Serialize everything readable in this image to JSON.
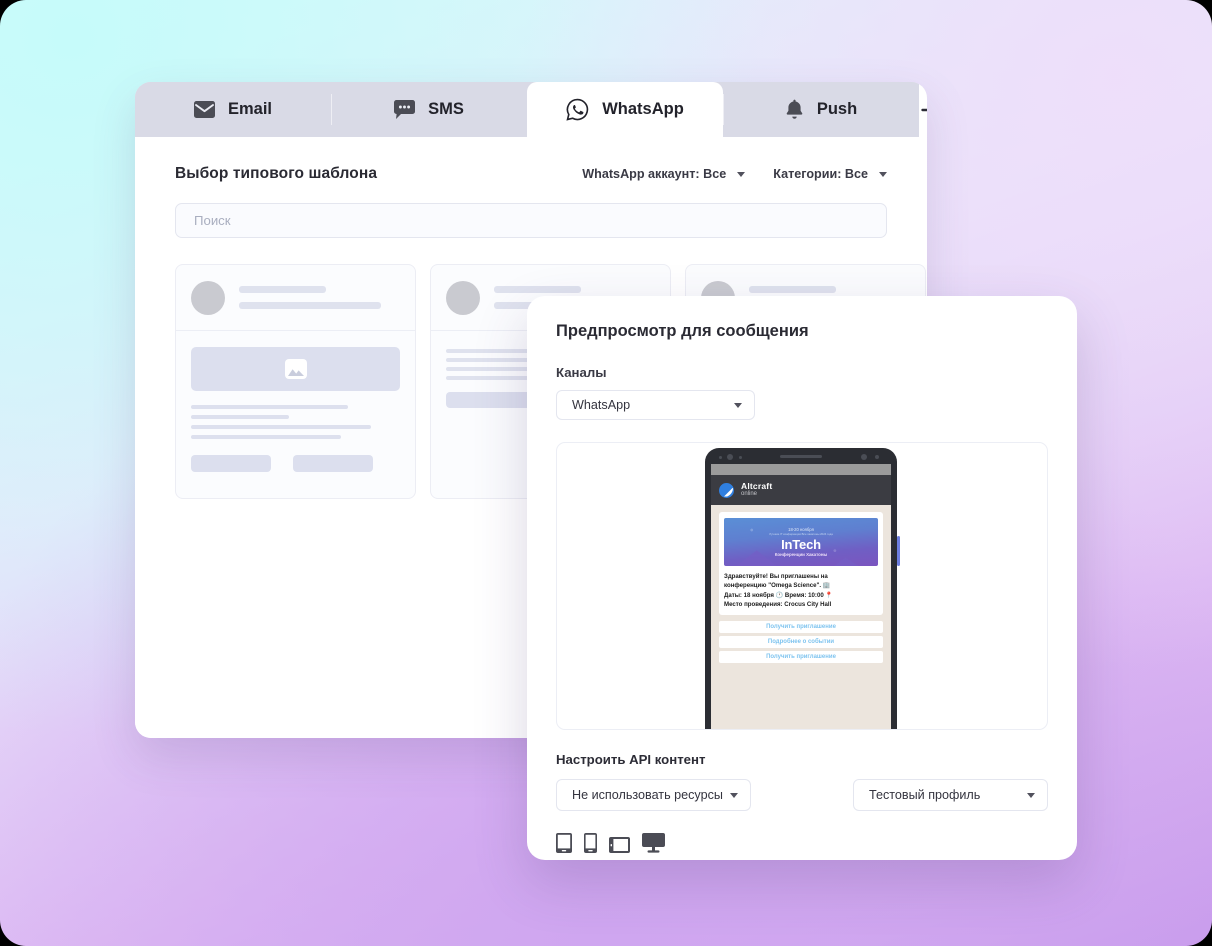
{
  "tabs": [
    {
      "id": "email",
      "label": "Email",
      "icon": "envelope-icon",
      "active": false
    },
    {
      "id": "sms",
      "label": "SMS",
      "icon": "speech-bubble-icon",
      "active": false
    },
    {
      "id": "whatsapp",
      "label": "WhatsApp",
      "icon": "whatsapp-icon",
      "active": true
    },
    {
      "id": "push",
      "label": "Push",
      "icon": "bell-icon",
      "active": false
    }
  ],
  "add_tab": {
    "label": "+",
    "icon": "plus-icon"
  },
  "panel": {
    "title": "Выбор типового шаблона",
    "filters": [
      {
        "id": "whatsapp-account",
        "label": "WhatsApp аккаунт: Все"
      },
      {
        "id": "categories",
        "label": "Категории: Все"
      }
    ],
    "search": {
      "placeholder": "Поиск",
      "value": ""
    }
  },
  "modal": {
    "title": "Предпросмотр для сообщения",
    "channels_label": "Каналы",
    "channel_value": "WhatsApp",
    "api_label": "Настроить API контент",
    "resource_value": "Не использовать ресурсы",
    "profile_value": "Тестовый профиль",
    "devices": [
      {
        "id": "tablet-portrait",
        "icon": "tablet-portrait-icon"
      },
      {
        "id": "phone-portrait",
        "icon": "phone-portrait-icon"
      },
      {
        "id": "tablet-landscape",
        "icon": "tablet-landscape-icon"
      },
      {
        "id": "desktop",
        "icon": "desktop-icon"
      }
    ]
  },
  "phone_preview": {
    "chat_title": "Altcraft",
    "chat_status": "online",
    "banner": {
      "date": "18-20 ноября",
      "subtitle_top": "Лучшие IT конференции\nВсе хакатоны 2024 года",
      "title": "InTech",
      "subtitle": "Конференции\nХакатоны"
    },
    "message_lines": [
      "Здравствуйте! Вы приглашены на",
      "конференцию \"Omega Science\". 🏢",
      "Даты: 18 ноября 🕐 Время: 10:00 📍",
      "Место проведения: Crocus City Hall"
    ],
    "buttons": [
      "Получить приглашение",
      "Подробнее о событии",
      "Получить приглашение"
    ]
  },
  "colors": {
    "accent_purple": "#cfa6f0",
    "accent_cyan": "#c6fbfa",
    "tabbar": "#d9dae6",
    "skeleton": "#dcdfee",
    "chat_bg": "#ece5dd",
    "link_blue": "#7fc4ef"
  }
}
